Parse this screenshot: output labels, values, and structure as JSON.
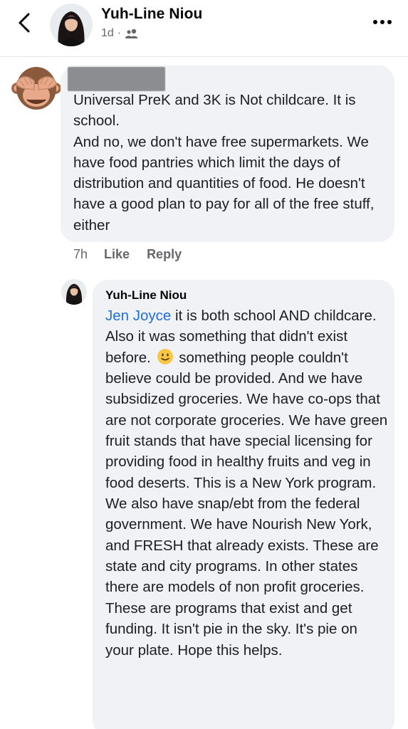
{
  "header": {
    "name": "Yuh-Line Niou",
    "time": "1d",
    "separator": "·",
    "audience_icon": "friends-icon"
  },
  "comment1": {
    "author_redacted": true,
    "text": "Universal PreK and 3K is Not childcare. It is school.\nAnd no, we don't have free supermarkets. We have food pantries which limit the days of distribution and quantities of food. He doesn't have a good plan to pay for all of the free stuff, either",
    "avatar_icon": "see-no-evil-monkey-icon",
    "time": "7h",
    "like_label": "Like",
    "reply_label": "Reply"
  },
  "reply1": {
    "name": "Yuh-Line Niou",
    "mention": "Jen Joyce",
    "text_before_emoji": " it is both school AND childcare. Also it was something that didn't exist before. ",
    "emoji_icon": "slightly-smiling-face-icon",
    "text_after_emoji": " something people couldn't believe could be provided. And we have subsidized groceries. We have co-ops that are not corporate groceries. We have green fruit stands that have special licensing for providing food in healthy fruits and veg in food deserts. This is a New York program. We also have snap/ebt from the federal government. We have Nourish New York, and FRESH that already exists. These are state and city programs. In other states there are models of non profit groceries. These are programs that exist and get funding. It isn't pie in the sky. It's pie on your plate. Hope this helps."
  },
  "colors": {
    "bubble": "#f0f2f5",
    "mention": "#216fdb",
    "secondary_text": "#65676b"
  }
}
